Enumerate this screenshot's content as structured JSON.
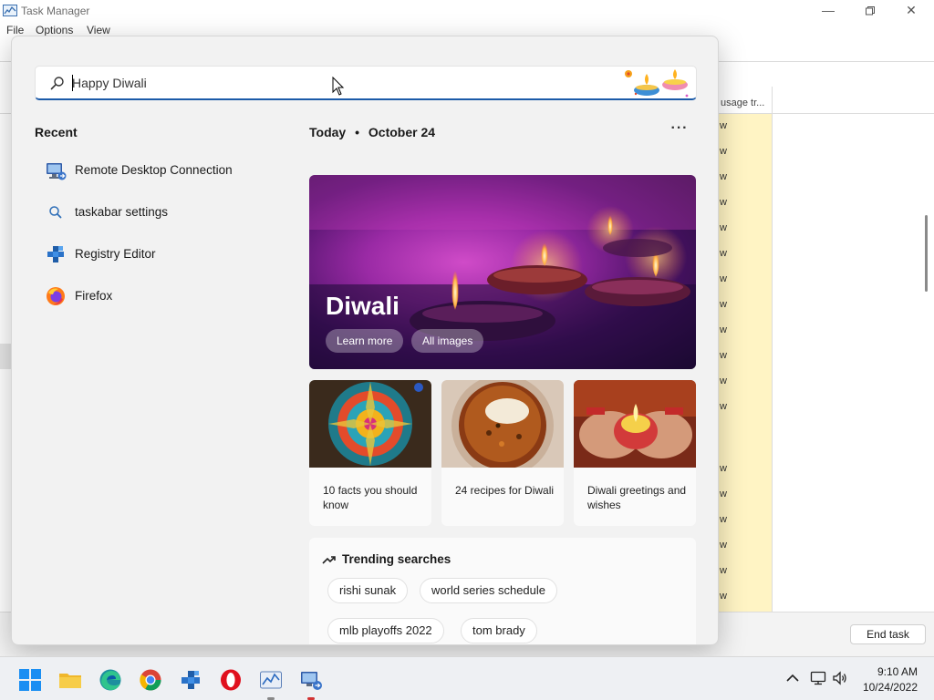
{
  "taskmanager": {
    "title": "Task Manager",
    "menu": [
      "File",
      "Options",
      "View"
    ],
    "column_header": "usage tr...",
    "column_cell": "w",
    "end_task": "End task",
    "window_controls": [
      "minimize-icon",
      "restore-icon",
      "close-icon"
    ]
  },
  "search": {
    "value": "Happy Diwali"
  },
  "recent": {
    "title": "Recent",
    "items": [
      {
        "label": "Remote Desktop Connection",
        "icon": "remote-desktop-icon"
      },
      {
        "label": "taskabar settings",
        "icon": "search-icon"
      },
      {
        "label": "Registry Editor",
        "icon": "registry-editor-icon"
      },
      {
        "label": "Firefox",
        "icon": "firefox-icon"
      }
    ]
  },
  "today": {
    "label": "Today",
    "separator": "•",
    "date": "October 24",
    "more": "···"
  },
  "hero": {
    "title": "Diwali",
    "learn_more": "Learn more",
    "all_images": "All images"
  },
  "cards": [
    {
      "text": "10 facts you should know"
    },
    {
      "text": "24 recipes for Diwali"
    },
    {
      "text": "Diwali greetings and wishes"
    }
  ],
  "trending": {
    "title": "Trending searches",
    "chips": [
      "rishi sunak",
      "world series schedule",
      "mlb playoffs 2022",
      "tom brady"
    ]
  },
  "taskbar": {
    "apps": [
      "windows-start-icon",
      "file-explorer-icon",
      "edge-icon",
      "chrome-icon",
      "registry-editor-icon",
      "opera-icon",
      "task-manager-icon",
      "remote-desktop-icon"
    ],
    "time": "9:10 AM",
    "date": "10/24/2022"
  },
  "colors": {
    "accent": "#1b5aa8",
    "highlight_column": "#fff4c4"
  }
}
